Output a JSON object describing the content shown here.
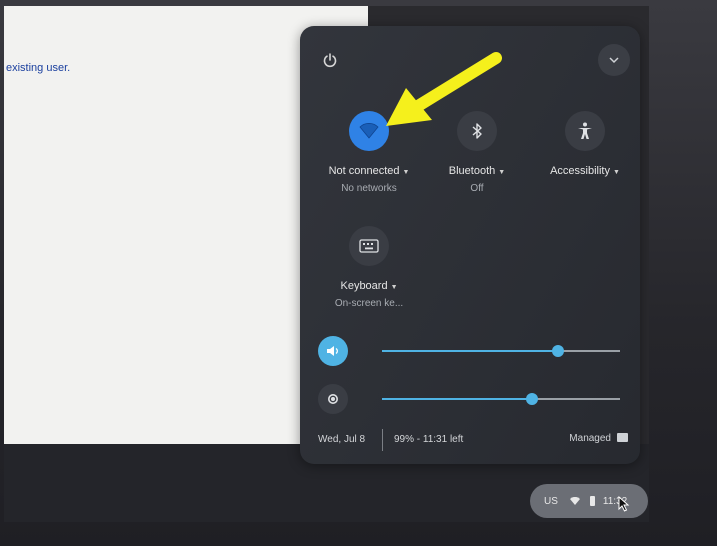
{
  "page": {
    "visible_text": "existing user."
  },
  "quick_settings": {
    "power_icon": "power-icon",
    "collapse_icon": "chevron-down-icon",
    "network": {
      "label": "Not connected",
      "sublabel": "No networks",
      "icon": "wifi-icon",
      "active_color": "#2f82e6"
    },
    "bluetooth": {
      "label": "Bluetooth",
      "sublabel": "Off",
      "icon": "bluetooth-icon"
    },
    "accessibility": {
      "label": "Accessibility",
      "icon": "accessibility-icon"
    },
    "keyboard": {
      "label": "Keyboard",
      "sublabel": "On-screen ke...",
      "icon": "keyboard-icon"
    },
    "volume": {
      "icon": "volume-icon",
      "level": 0.74
    },
    "brightness": {
      "icon": "brightness-icon",
      "level": 0.63
    },
    "footer": {
      "date": "Wed, Jul 8",
      "battery": "99% - 11:31 left",
      "managed": "Managed"
    },
    "accent_color": "#4fb3e4"
  },
  "shelf": {
    "ime": "US",
    "time": "11:32"
  }
}
